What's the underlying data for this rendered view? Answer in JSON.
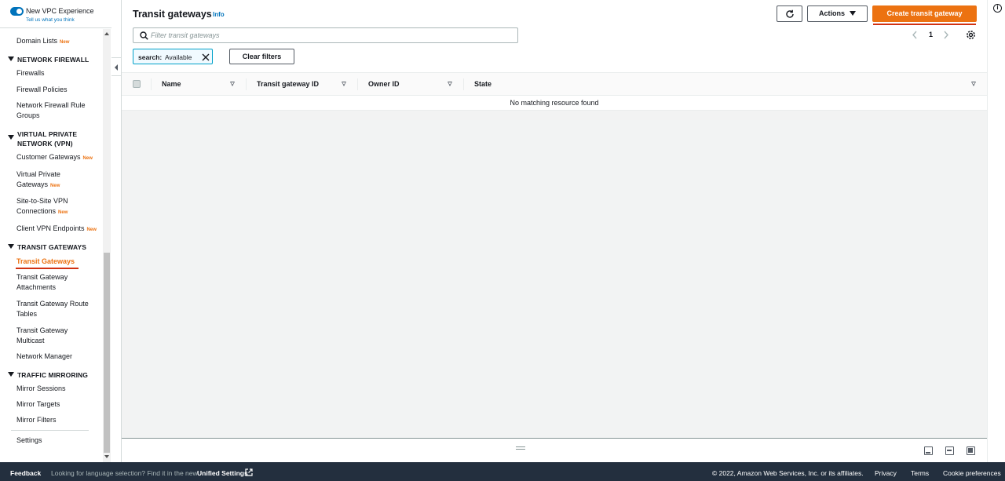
{
  "experience_toggle": {
    "title": "New VPC Experience",
    "link": "Tell us what you think"
  },
  "sidebar": {
    "domain_lists": "Domain Lists",
    "new_badge": "New",
    "sections": {
      "network_firewall": "NETWORK FIREWALL",
      "vpn": "VIRTUAL PRIVATE NETWORK (VPN)",
      "transit_gateways": "TRANSIT GATEWAYS",
      "traffic_mirroring": "TRAFFIC MIRRORING"
    },
    "items": {
      "firewalls": "Firewalls",
      "firewall_policies": "Firewall Policies",
      "rule_groups": "Network Firewall Rule Groups",
      "customer_gateways": "Customer Gateways",
      "virtual_private_gateways": "Virtual Private Gateways",
      "site_to_site": "Site-to-Site VPN Connections",
      "client_vpn": "Client VPN Endpoints",
      "transit_gateways": "Transit Gateways",
      "tgw_attachments": "Transit Gateway Attachments",
      "tgw_route_tables": "Transit Gateway Route Tables",
      "tgw_multicast": "Transit Gateway Multicast",
      "network_manager": "Network Manager",
      "mirror_sessions": "Mirror Sessions",
      "mirror_targets": "Mirror Targets",
      "mirror_filters": "Mirror Filters",
      "settings": "Settings"
    },
    "active_item": "Transit Gateways"
  },
  "header": {
    "title": "Transit gateways",
    "info": "Info",
    "actions_label": "Actions",
    "create_label": "Create transit gateway"
  },
  "search": {
    "placeholder": "Filter transit gateways"
  },
  "pagination": {
    "current_page": "1"
  },
  "filter": {
    "key": "search:",
    "value": "Available",
    "clear_label": "Clear filters"
  },
  "table": {
    "columns": [
      "Name",
      "Transit gateway ID",
      "Owner ID",
      "State"
    ],
    "empty_message": "No matching resource found"
  },
  "footer": {
    "feedback": "Feedback",
    "language_message": "Looking for language selection? Find it in the new",
    "unified_settings": "Unified Settings",
    "copyright": "© 2022, Amazon Web Services, Inc. or its affiliates.",
    "privacy": "Privacy",
    "terms": "Terms",
    "cookies": "Cookie preferences"
  },
  "colors": {
    "accent": "#ec7211",
    "link": "#0073bb",
    "footer_bg": "#232f3e"
  }
}
